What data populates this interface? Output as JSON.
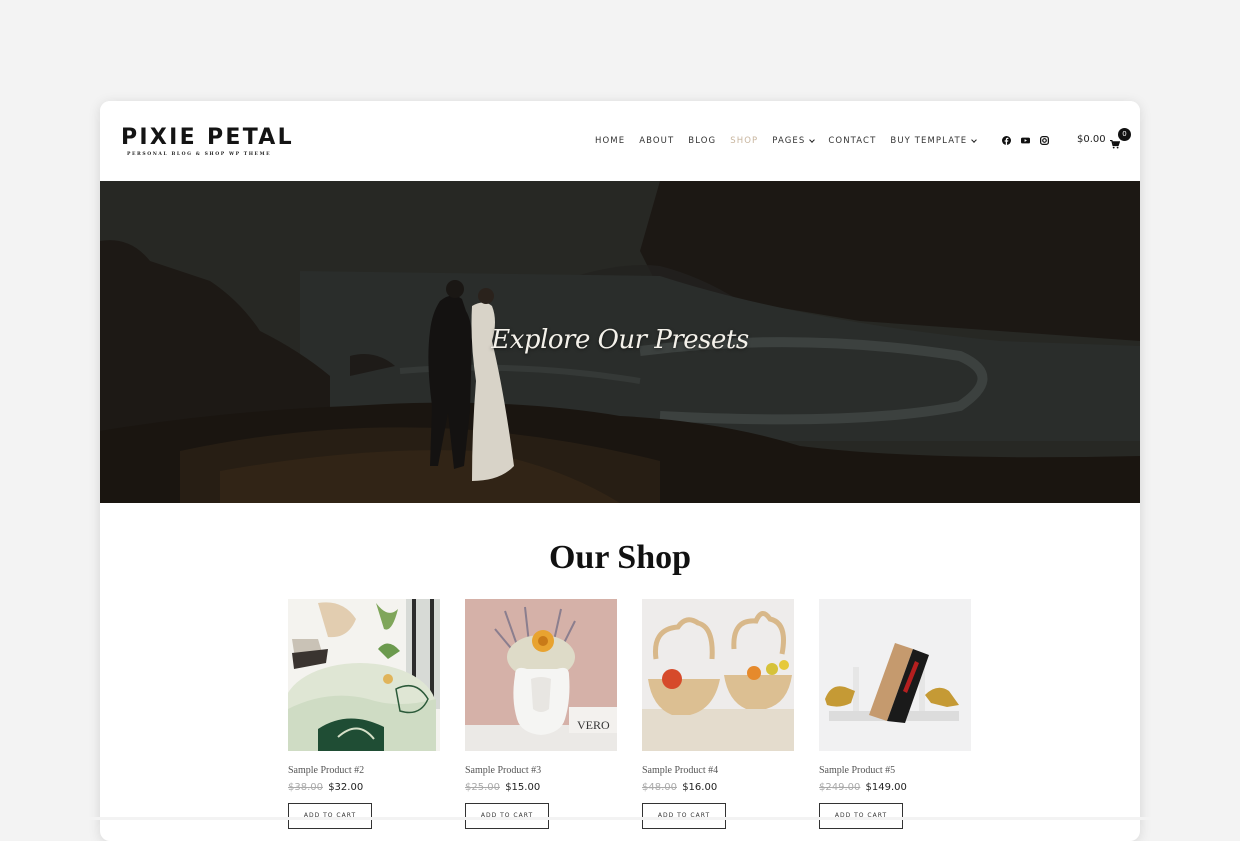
{
  "header": {
    "logo_title": "PIXIE PETAL",
    "logo_subtitle": "PERSONAL BLOG & SHOP WP THEME",
    "nav": [
      {
        "label": "HOME",
        "dropdown": false,
        "active": false
      },
      {
        "label": "ABOUT",
        "dropdown": false,
        "active": false
      },
      {
        "label": "BLOG",
        "dropdown": false,
        "active": false
      },
      {
        "label": "SHOP",
        "dropdown": false,
        "active": true
      },
      {
        "label": "PAGES",
        "dropdown": true,
        "active": false
      },
      {
        "label": "CONTACT",
        "dropdown": false,
        "active": false
      },
      {
        "label": "BUY TEMPLATE",
        "dropdown": true,
        "active": false
      }
    ],
    "social_icons": [
      "facebook-icon",
      "youtube-icon",
      "instagram-icon"
    ],
    "cart_total": "$0.00",
    "cart_count": "0"
  },
  "hero": {
    "title": "Explore Our Presets"
  },
  "shop": {
    "title": "Our Shop",
    "add_to_cart_label": "ADD TO CART",
    "products": [
      {
        "name": "Sample Product #2",
        "old_price": "$38.00",
        "price": "$32.00",
        "image": "round-rug-with-plants"
      },
      {
        "name": "Sample Product #3",
        "old_price": "$25.00",
        "price": "$15.00",
        "image": "face-vase-with-dried-flowers"
      },
      {
        "name": "Sample Product #4",
        "old_price": "$48.00",
        "price": "$16.00",
        "image": "apple-shaped-wooden-baskets"
      },
      {
        "name": "Sample Product #5",
        "old_price": "$249.00",
        "price": "$149.00",
        "image": "marble-leopard-bookends"
      }
    ]
  },
  "colors": {
    "accent": "#c8b59e",
    "text": "#333333",
    "background": "#f3f3f3"
  }
}
